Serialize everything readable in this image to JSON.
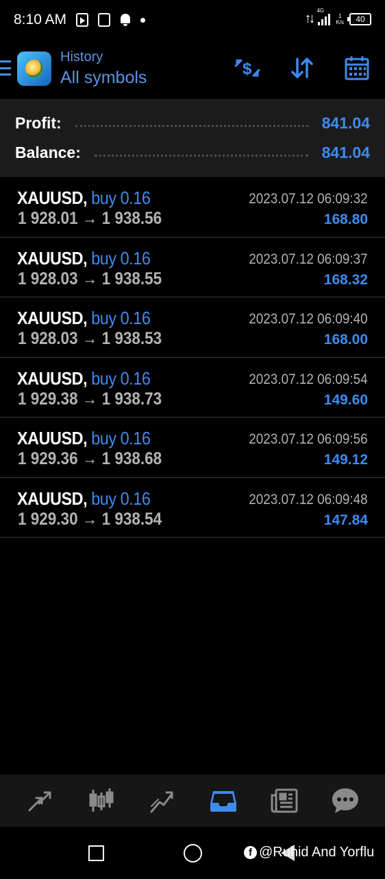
{
  "status_bar": {
    "time": "8:10 AM",
    "network_label": "4G",
    "speed_value": "1",
    "speed_unit": "K/s",
    "battery": "40"
  },
  "header": {
    "subtitle": "History",
    "title": "All symbols",
    "actions": [
      "dollar-exchange-icon",
      "sort-arrows-icon",
      "calendar-icon"
    ]
  },
  "summary": {
    "profit_label": "Profit:",
    "profit_value": "841.04",
    "balance_label": "Balance:",
    "balance_value": "841.04"
  },
  "deals": [
    {
      "symbol": "XAUUSD,",
      "side": "buy 0.16",
      "open": "1 928.01",
      "arrow": "→",
      "close": "1 938.56",
      "time": "2023.07.12 06:09:32",
      "profit": "168.80"
    },
    {
      "symbol": "XAUUSD,",
      "side": "buy 0.16",
      "open": "1 928.03",
      "arrow": "→",
      "close": "1 938.55",
      "time": "2023.07.12 06:09:37",
      "profit": "168.32"
    },
    {
      "symbol": "XAUUSD,",
      "side": "buy 0.16",
      "open": "1 928.03",
      "arrow": "→",
      "close": "1 938.53",
      "time": "2023.07.12 06:09:40",
      "profit": "168.00"
    },
    {
      "symbol": "XAUUSD,",
      "side": "buy 0.16",
      "open": "1 929.38",
      "arrow": "→",
      "close": "1 938.73",
      "time": "2023.07.12 06:09:54",
      "profit": "149.60"
    },
    {
      "symbol": "XAUUSD,",
      "side": "buy 0.16",
      "open": "1 929.36",
      "arrow": "→",
      "close": "1 938.68",
      "time": "2023.07.12 06:09:56",
      "profit": "149.12"
    },
    {
      "symbol": "XAUUSD,",
      "side": "buy 0.16",
      "open": "1 929.30",
      "arrow": "→",
      "close": "1 938.54",
      "time": "2023.07.12 06:09:48",
      "profit": "147.84"
    }
  ],
  "bottom_nav": {
    "items": [
      "quotes-icon",
      "chart-icon",
      "trade-icon",
      "history-icon",
      "news-icon",
      "messages-icon"
    ],
    "active": "history-icon"
  },
  "watermark": {
    "logo": "f",
    "text": "@Ruhid And Yorflu"
  },
  "colors": {
    "accent": "#3d8bf0",
    "header_text": "#5b93e6",
    "muted": "#b3b3b3",
    "background": "#000000",
    "panel": "#1b1b1b"
  }
}
